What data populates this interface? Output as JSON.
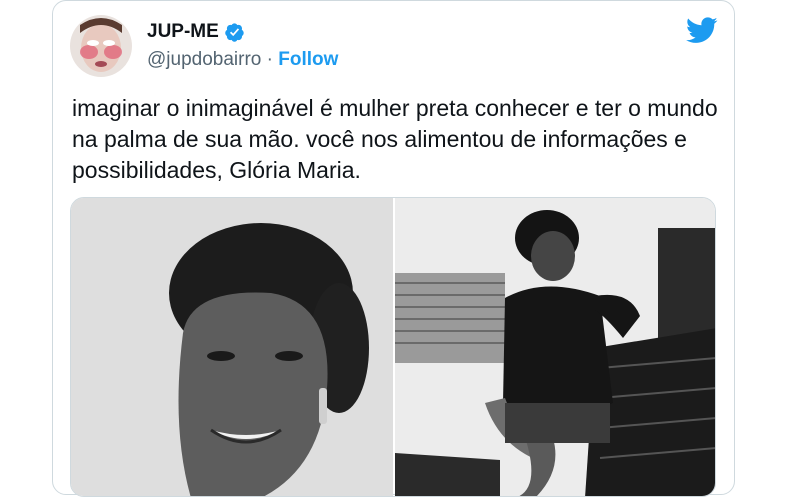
{
  "tweet": {
    "author_name": "JUP-ME",
    "handle": "@jupdobairro",
    "separator": " · ",
    "follow_label": "Follow",
    "text": "imaginar o inimaginável é mulher preta conhecer e ter o mundo na palma de sua mão. você nos alimentou de informações e possibilidades, Glória Maria.",
    "icons": {
      "platform": "twitter-bird-icon",
      "verified": "verified-badge-icon"
    },
    "colors": {
      "accent": "#1d9bf0",
      "text": "#0f1419",
      "muted": "#536471",
      "border": "#cfd9de"
    }
  },
  "media": {
    "count": 2,
    "photos": [
      {
        "kind": "black-and-white portrait"
      },
      {
        "kind": "black-and-white seated woman"
      }
    ]
  }
}
